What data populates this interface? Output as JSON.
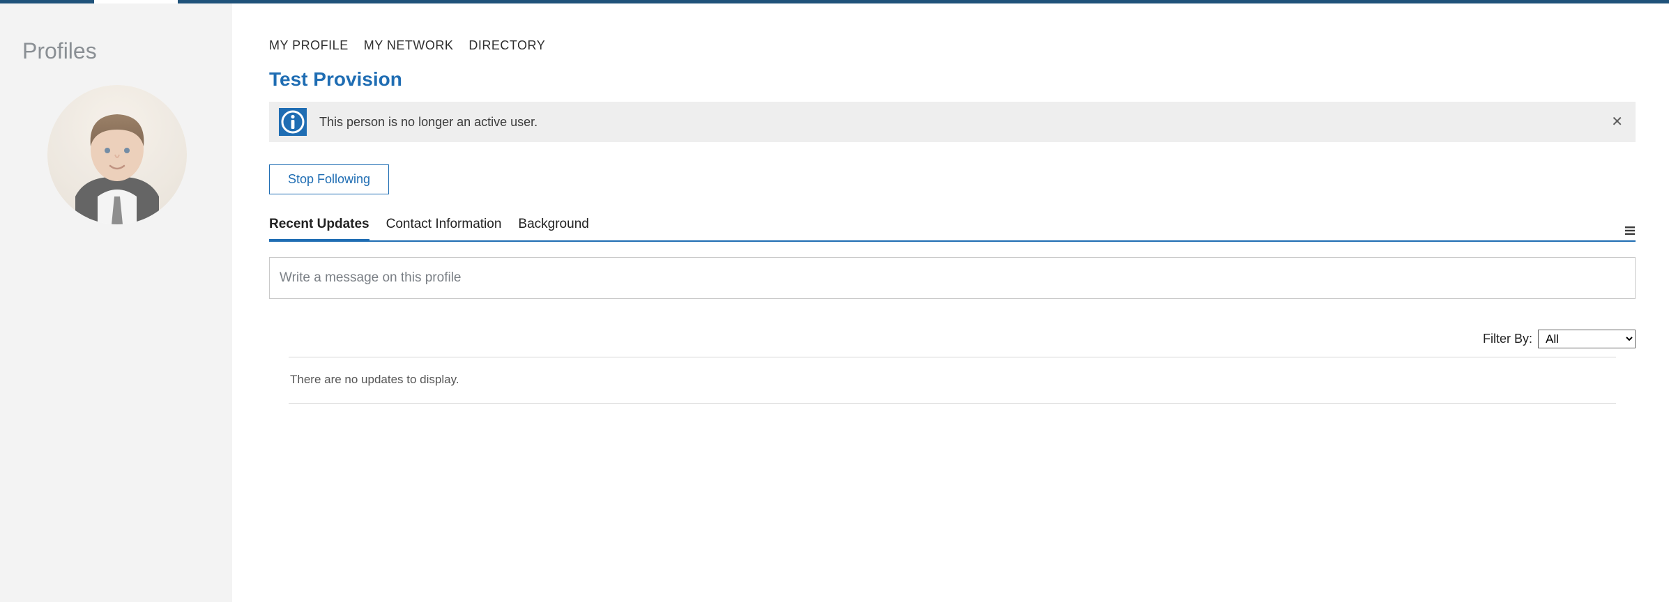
{
  "sidebar": {
    "title": "Profiles"
  },
  "nav": {
    "items": [
      "MY PROFILE",
      "MY NETWORK",
      "DIRECTORY"
    ]
  },
  "profile": {
    "name": "Test Provision",
    "alert_text": "This person is no longer an active user.",
    "stop_following_label": "Stop Following"
  },
  "tabs": {
    "items": [
      "Recent Updates",
      "Contact Information",
      "Background"
    ],
    "active_index": 0
  },
  "compose": {
    "placeholder": "Write a message on this profile"
  },
  "filter": {
    "label": "Filter By:",
    "selected": "All",
    "options": [
      "All"
    ]
  },
  "updates": {
    "empty_text": "There are no updates to display."
  }
}
